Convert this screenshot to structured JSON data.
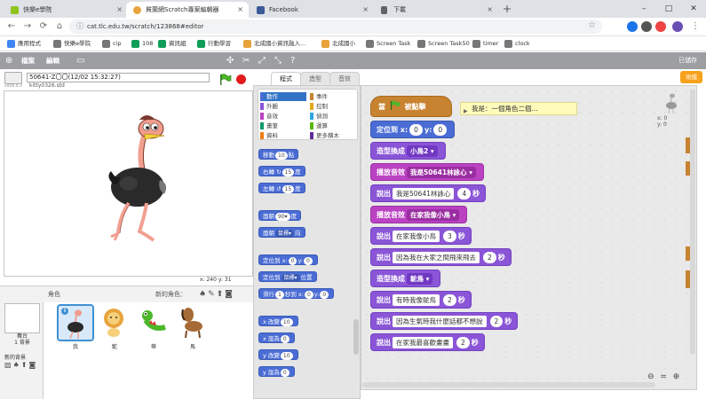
{
  "browser": {
    "tabs": [
      {
        "title": "快樂e學院",
        "close": "×"
      },
      {
        "title": "貧蘭網Scratch專案編輯器",
        "close": "×"
      },
      {
        "title": "Facebook",
        "close": "×"
      },
      {
        "title": "下載",
        "close": "×"
      }
    ],
    "new_tab": "+",
    "window_controls": {
      "minimize": "–",
      "maximize": "□",
      "close": "✕"
    },
    "url": "cat.tlc.edu.tw/scratch/123868#editor",
    "bookmarks": [
      "應用程式",
      "快樂e學院",
      "cip",
      "108",
      "資訊組",
      "行動學習",
      "北成國小資訊融入...",
      "北成國小",
      "Screen Task",
      "Screen Task50",
      "timer",
      "clock"
    ]
  },
  "scratch_menu": {
    "file": "檔案",
    "edit": "編輯",
    "right_status": "已儲存"
  },
  "project": {
    "title": "50641-Z〇〇(12/02 15:32:27)",
    "author": "kitty0326.std",
    "version": "v456.0.3"
  },
  "stage": {
    "coords": "x: 240  y: 31"
  },
  "sprites": {
    "header": "角色",
    "new_sprite_label": "新的角色：",
    "stage_label": "舞台",
    "stage_sub": "1 背景",
    "new_backdrop_label": "新的背景",
    "items": [
      {
        "name": "我",
        "selected": true
      },
      {
        "name": "鴕",
        "selected": false
      },
      {
        "name": "蒂",
        "selected": false
      },
      {
        "name": "馬",
        "selected": false
      }
    ]
  },
  "tabs": [
    "程式",
    "造型",
    "音效"
  ],
  "add_button": "攻擋",
  "categories": [
    {
      "label": "動作",
      "color": "#4a6cd4",
      "active": true
    },
    {
      "label": "事件",
      "color": "#c88330",
      "active": false
    },
    {
      "label": "外觀",
      "color": "#8a55d7",
      "active": false
    },
    {
      "label": "控制",
      "color": "#e1a91a",
      "active": false
    },
    {
      "label": "音效",
      "color": "#bb42c3",
      "active": false
    },
    {
      "label": "偵測",
      "color": "#2ca5e2",
      "active": false
    },
    {
      "label": "畫筆",
      "color": "#0e9a6c",
      "active": false
    },
    {
      "label": "運算",
      "color": "#5cb712",
      "active": false
    },
    {
      "label": "資料",
      "color": "#ee7d16",
      "active": false
    },
    {
      "label": "更多積木",
      "color": "#632d99",
      "active": false
    }
  ],
  "palette_blocks": {
    "move": {
      "pre": "移動",
      "val": "10",
      "post": "點"
    },
    "turn_right": {
      "pre": "右轉",
      "val": "15",
      "post": "度"
    },
    "turn_left": {
      "pre": "左轉",
      "val": "15",
      "post": "度"
    },
    "point_dir": {
      "pre": "面朝",
      "val": "90▾",
      "post": "度"
    },
    "point_towards": {
      "pre": "面朝",
      "val": "鼠標▾",
      "post": "向"
    },
    "goto_xy": {
      "pre": "定位到 x:",
      "v1": "0",
      "mid": "y:",
      "v2": "0"
    },
    "goto": {
      "pre": "定位到",
      "val": "鼠標▾",
      "post": "位置"
    },
    "glide": {
      "pre": "滑行",
      "v1": "1",
      "mid": "秒到 x:",
      "v2": "0",
      "mid2": "y:",
      "v3": "0"
    },
    "change_x": {
      "pre": "x 改變",
      "val": "10"
    },
    "set_x": {
      "pre": "x 設為",
      "val": "0"
    },
    "change_y": {
      "pre": "y 改變",
      "val": "10"
    },
    "set_y": {
      "pre": "y 設為",
      "val": "0"
    }
  },
  "script": {
    "hat_pre": "當",
    "hat_post": "被點擊",
    "comment": "我是：一個角色二個...",
    "blocks": [
      {
        "type": "motion",
        "parts": [
          "定位到 x:",
          {
            "in": "0"
          },
          "y:",
          {
            "in": "0"
          }
        ]
      },
      {
        "type": "looks",
        "parts": [
          "造型換成",
          {
            "dd": "小鳥2 ▾"
          }
        ]
      },
      {
        "type": "sound",
        "parts": [
          "播放音效",
          {
            "dd": "我是50641林詠心 ▾"
          }
        ]
      },
      {
        "type": "looks",
        "parts": [
          "說出",
          {
            "sq": "我是50641林詠心"
          },
          {
            "in": "4"
          },
          "秒"
        ]
      },
      {
        "type": "sound",
        "parts": [
          "播放音效",
          {
            "dd": "在家我像小鳥 ▾"
          }
        ]
      },
      {
        "type": "looks",
        "parts": [
          "說出",
          {
            "sq": "在家我像小鳥"
          },
          {
            "in": "3"
          },
          "秒"
        ]
      },
      {
        "type": "looks",
        "parts": [
          "說出",
          {
            "sq": "因為我在大家之間飛來飛去"
          },
          {
            "in": "2"
          },
          "秒"
        ]
      },
      {
        "type": "looks",
        "parts": [
          "造型換成",
          {
            "dd": "鴕鳥 ▾"
          }
        ]
      },
      {
        "type": "looks",
        "parts": [
          "說出",
          {
            "sq": "有時我像鴕鳥"
          },
          {
            "in": "2"
          },
          "秒"
        ]
      },
      {
        "type": "looks",
        "parts": [
          "說出",
          {
            "sq": "因為生氣時我什麼話都不想說"
          },
          {
            "in": "2"
          },
          "秒"
        ]
      },
      {
        "type": "looks",
        "parts": [
          "說出",
          {
            "sq": "在家我最喜歡畫畫"
          },
          {
            "in": "2"
          },
          "秒"
        ]
      }
    ],
    "corner_x": "x: 0",
    "corner_y": "y: 0",
    "zoom": "⊖ = ⊕"
  }
}
